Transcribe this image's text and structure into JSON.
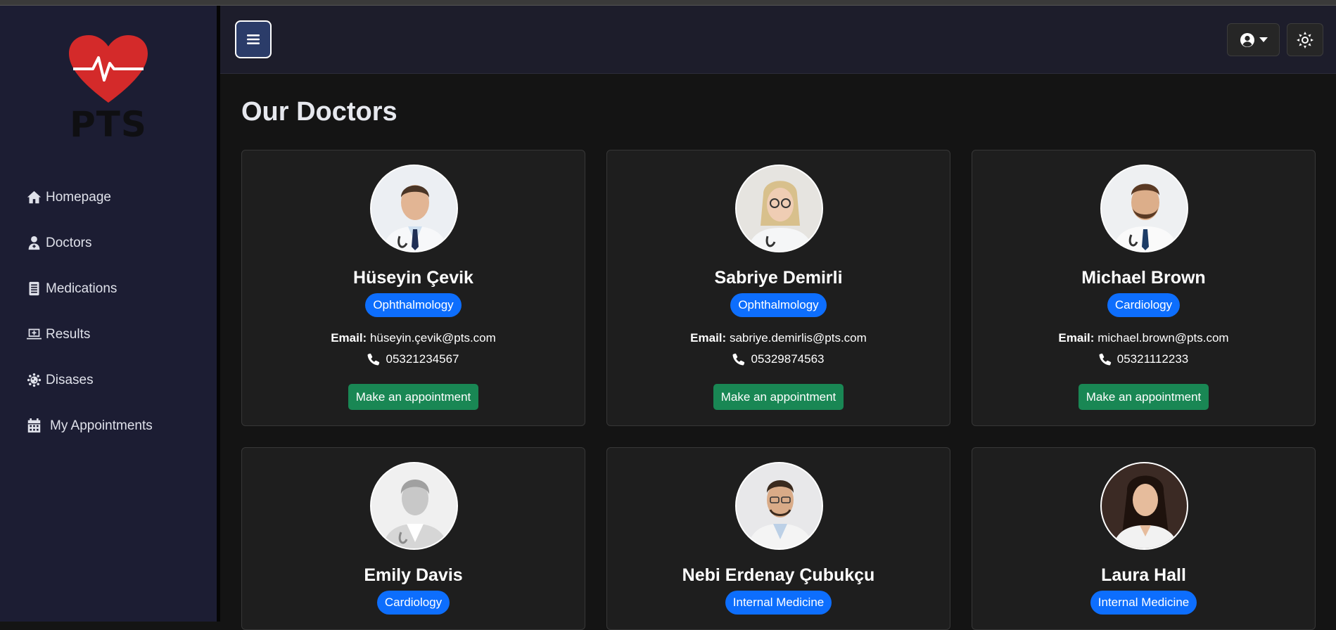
{
  "app": {
    "logo_text": "PTS"
  },
  "sidebar": {
    "items": [
      {
        "label": "Homepage",
        "icon": "home-icon"
      },
      {
        "label": "Doctors",
        "icon": "user-doctor-icon"
      },
      {
        "label": "Medications",
        "icon": "prescription-icon"
      },
      {
        "label": "Results",
        "icon": "laptop-medical-icon"
      },
      {
        "label": "Disases",
        "icon": "virus-icon"
      },
      {
        "label": "My Appointments",
        "icon": "calendar-icon"
      }
    ]
  },
  "header": {
    "menu_icon": "bars-icon",
    "user_icon": "user-circle-icon",
    "theme_icon": "sun-icon"
  },
  "main": {
    "title": "Our Doctors",
    "doctors": [
      {
        "name": "Hüseyin Çevik",
        "specialty": "Ophthalmology",
        "email_label": "Email:",
        "email": "hüseyin.çevik@pts.com",
        "phone": "05321234567",
        "button": "Make an appointment"
      },
      {
        "name": "Sabriye Demirli",
        "specialty": "Ophthalmology",
        "email_label": "Email:",
        "email": "sabriye.demirlis@pts.com",
        "phone": "05329874563",
        "button": "Make an appointment"
      },
      {
        "name": "Michael Brown",
        "specialty": "Cardiology",
        "email_label": "Email:",
        "email": "michael.brown@pts.com",
        "phone": "05321112233",
        "button": "Make an appointment"
      },
      {
        "name": "Emily Davis",
        "specialty": "Cardiology"
      },
      {
        "name": "Nebi Erdenay Çubukçu",
        "specialty": "Internal Medicine"
      },
      {
        "name": "Laura Hall",
        "specialty": "Internal Medicine"
      }
    ]
  },
  "colors": {
    "sidebar_bg": "#1c1d33",
    "badge": "#0d6efd",
    "appointment": "#198754",
    "logo_heart": "#d42a2a"
  }
}
